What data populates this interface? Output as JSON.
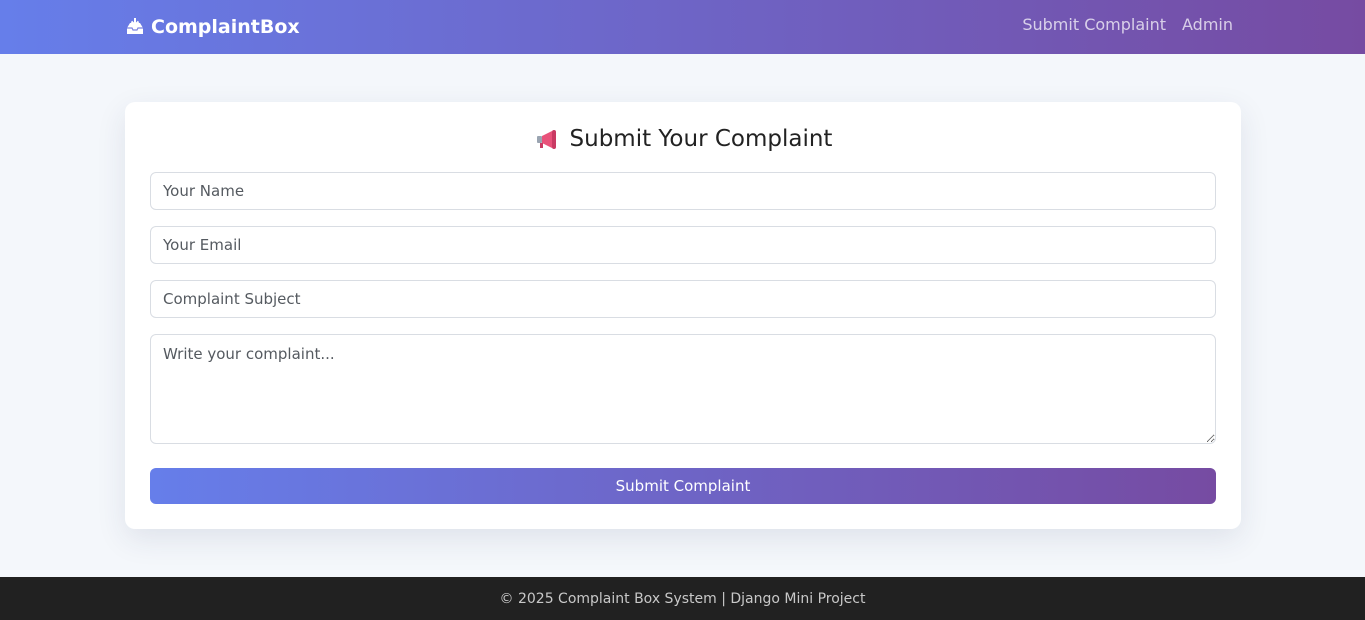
{
  "navbar": {
    "brand_icon": "inbox-tray-icon",
    "brand": "ComplaintBox",
    "links": [
      "Submit Complaint",
      "Admin"
    ]
  },
  "form": {
    "title_icon": "megaphone-icon",
    "title": "Submit Your Complaint",
    "name_placeholder": "Your Name",
    "email_placeholder": "Your Email",
    "subject_placeholder": "Complaint Subject",
    "message_placeholder": "Write your complaint...",
    "submit_label": "Submit Complaint"
  },
  "footer": {
    "text": "© 2025 Complaint Box System | Django Mini Project"
  },
  "colors": {
    "gradient_start": "#667eea",
    "gradient_end": "#764ba2",
    "page_bg": "#f4f7fb",
    "footer_bg": "#212121"
  }
}
